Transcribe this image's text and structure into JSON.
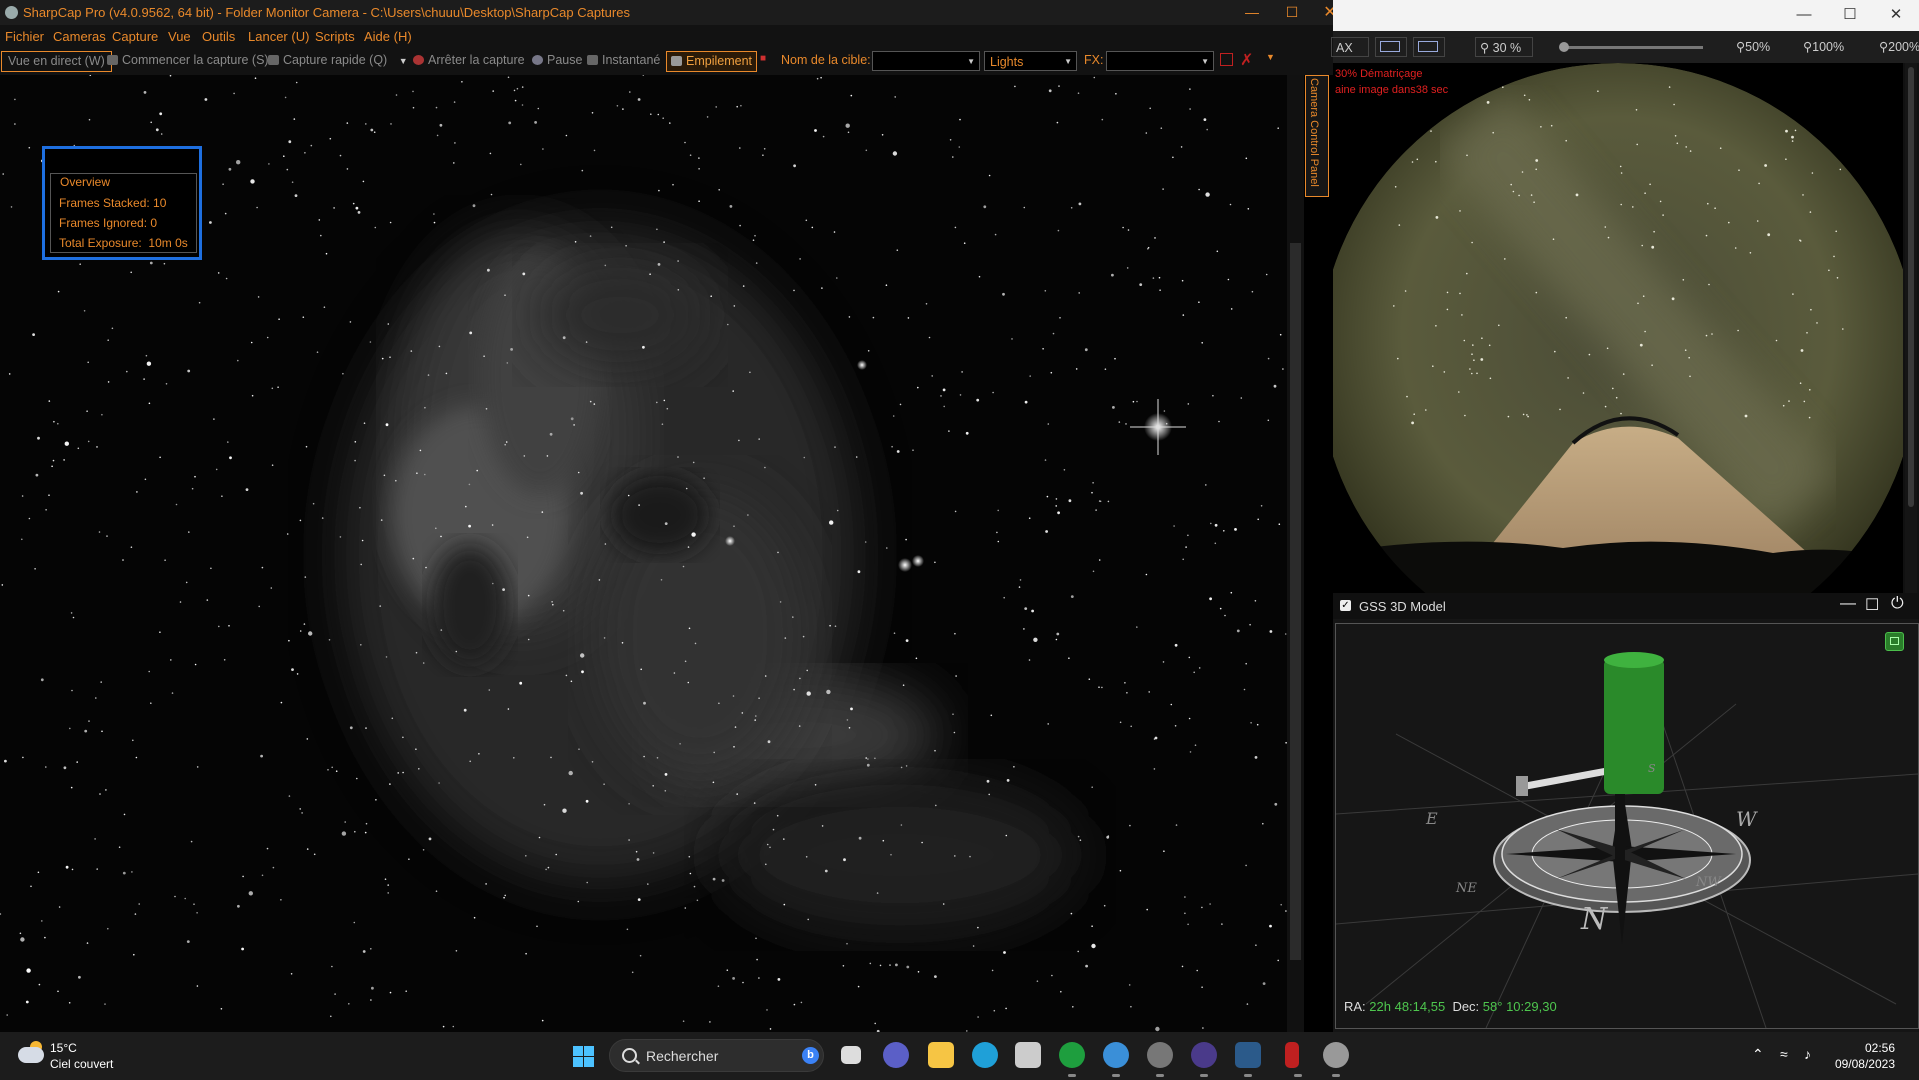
{
  "sharpcap": {
    "title": "SharpCap Pro (v4.0.9562, 64 bit) - Folder Monitor Camera - C:\\Users\\chuuu\\Desktop\\SharpCap Captures",
    "menu": [
      "Fichier",
      "Cameras",
      "Capture",
      "Vue",
      "Outils",
      "Lancer (U)",
      "Scripts",
      "Aide (H)"
    ],
    "toolbar": {
      "live": "Vue en direct (W)",
      "start_capture": "Commencer la capture (S)",
      "quick_capture": "Capture rapide (Q)",
      "stop_capture": "Arrêter la capture",
      "pause": "Pause",
      "snapshot": "Instantané",
      "stacking": "Empilement",
      "target_label": "Nom de la cible:",
      "target_value": "",
      "frame_type": "Lights",
      "fx_label": "FX:",
      "fx_value": ""
    },
    "camera_control_panel": "Camera Control Panel",
    "overview": {
      "title": "Overview",
      "frames_stacked_label": "Frames Stacked:",
      "frames_stacked": "10",
      "frames_ignored_label": "Frames Ignored:",
      "frames_ignored": "0",
      "total_exposure_label": "Total Exposure:",
      "total_exposure": "10m 0s"
    }
  },
  "allsky": {
    "toolbar": {
      "fit_label": "AX",
      "zoom_current": "30 %",
      "zoom_presets": [
        "50%",
        "100%",
        "200%"
      ]
    },
    "overlay_line1": "30%   Dématriçage",
    "overlay_line2": "aine image dans38 sec",
    "zoom_slider": 0.0
  },
  "gss": {
    "title": "GSS 3D Model",
    "ra_label": "RA:",
    "ra_value": "22h 48:14,55",
    "dec_label": "Dec:",
    "dec_value": "58° 10:29,30",
    "compass": {
      "n": "N",
      "s": "S",
      "e": "E",
      "w": "W",
      "ne": "NE",
      "nw": "NW"
    }
  },
  "taskbar": {
    "weather_temp": "15°C",
    "weather_desc": "Ciel couvert",
    "search_placeholder": "Rechercher",
    "time": "02:56",
    "date": "09/08/2023"
  },
  "colors": {
    "accent": "#e9892b",
    "overview_border": "#1e6fe0",
    "coord_green": "#4ec64e",
    "mount_green": "#2a8a2a"
  }
}
